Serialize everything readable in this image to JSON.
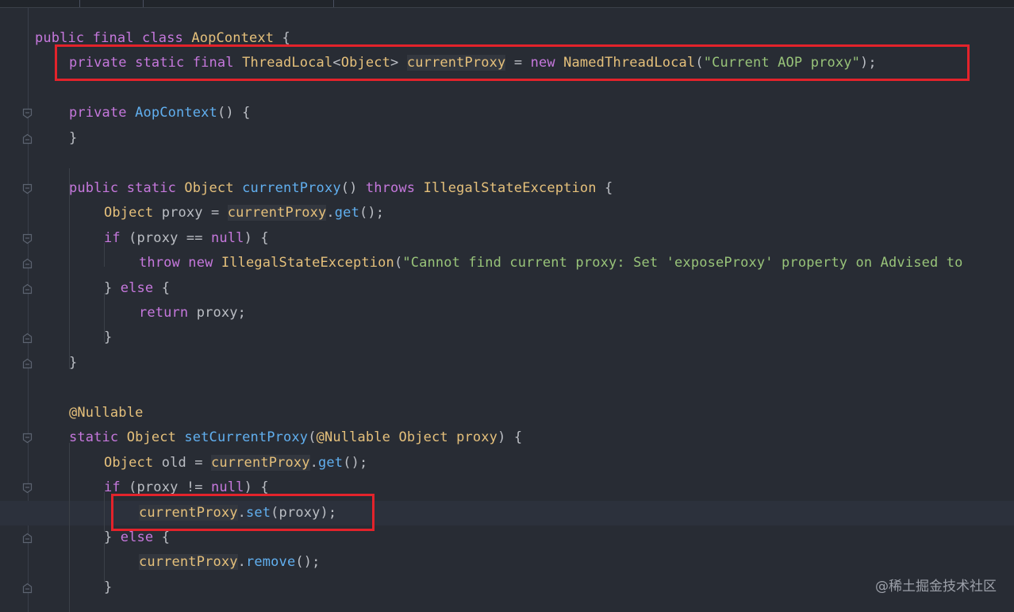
{
  "editor": {
    "lines": [
      {
        "id": "l1",
        "tokens": [
          {
            "c": "k",
            "t": "public final class "
          },
          {
            "c": "t",
            "t": "AopContext"
          },
          {
            "c": "p",
            "t": " {"
          }
        ]
      },
      {
        "id": "l2",
        "tokens": [
          {
            "c": "k",
            "t": "private static final "
          },
          {
            "c": "t",
            "t": "ThreadLocal"
          },
          {
            "c": "p",
            "t": "<"
          },
          {
            "c": "t",
            "t": "Object"
          },
          {
            "c": "p",
            "t": "> "
          },
          {
            "c": "v hl",
            "t": "currentProxy"
          },
          {
            "c": "p",
            "t": " = "
          },
          {
            "c": "k",
            "t": "new "
          },
          {
            "c": "t",
            "t": "NamedThreadLocal"
          },
          {
            "c": "p",
            "t": "("
          },
          {
            "c": "s",
            "t": "\"Current AOP proxy\""
          },
          {
            "c": "p",
            "t": ");"
          }
        ]
      },
      {
        "id": "l3",
        "tokens": []
      },
      {
        "id": "l4",
        "tokens": [
          {
            "c": "k",
            "t": "private "
          },
          {
            "c": "f",
            "t": "AopContext"
          },
          {
            "c": "p",
            "t": "() {"
          }
        ]
      },
      {
        "id": "l5",
        "tokens": [
          {
            "c": "p",
            "t": "}"
          }
        ]
      },
      {
        "id": "l6",
        "tokens": []
      },
      {
        "id": "l7",
        "tokens": [
          {
            "c": "k",
            "t": "public static "
          },
          {
            "c": "t",
            "t": "Object "
          },
          {
            "c": "f",
            "t": "currentProxy"
          },
          {
            "c": "p",
            "t": "() "
          },
          {
            "c": "k",
            "t": "throws "
          },
          {
            "c": "t",
            "t": "IllegalStateException"
          },
          {
            "c": "p",
            "t": " {"
          }
        ]
      },
      {
        "id": "l8",
        "tokens": [
          {
            "c": "t",
            "t": "Object"
          },
          {
            "c": "p",
            "t": " proxy = "
          },
          {
            "c": "v hl",
            "t": "currentProxy"
          },
          {
            "c": "p",
            "t": "."
          },
          {
            "c": "f",
            "t": "get"
          },
          {
            "c": "p",
            "t": "();"
          }
        ]
      },
      {
        "id": "l9",
        "tokens": [
          {
            "c": "k",
            "t": "if "
          },
          {
            "c": "p",
            "t": "(proxy == "
          },
          {
            "c": "k",
            "t": "null"
          },
          {
            "c": "p",
            "t": ") {"
          }
        ]
      },
      {
        "id": "l10",
        "tokens": [
          {
            "c": "k",
            "t": "throw new "
          },
          {
            "c": "t",
            "t": "IllegalStateException"
          },
          {
            "c": "p",
            "t": "("
          },
          {
            "c": "s",
            "t": "\"Cannot find current proxy: Set 'exposeProxy' property on Advised to"
          }
        ]
      },
      {
        "id": "l11",
        "tokens": [
          {
            "c": "p",
            "t": "} "
          },
          {
            "c": "k",
            "t": "else "
          },
          {
            "c": "p",
            "t": "{"
          }
        ]
      },
      {
        "id": "l12",
        "tokens": [
          {
            "c": "k",
            "t": "return "
          },
          {
            "c": "p",
            "t": "proxy;"
          }
        ]
      },
      {
        "id": "l13",
        "tokens": [
          {
            "c": "p",
            "t": "}"
          }
        ]
      },
      {
        "id": "l14",
        "tokens": [
          {
            "c": "p",
            "t": "}"
          }
        ]
      },
      {
        "id": "l15",
        "tokens": []
      },
      {
        "id": "l16",
        "tokens": [
          {
            "c": "ann",
            "t": "@Nullable"
          }
        ]
      },
      {
        "id": "l17",
        "tokens": [
          {
            "c": "k",
            "t": "static "
          },
          {
            "c": "t",
            "t": "Object "
          },
          {
            "c": "f",
            "t": "setCurrentProxy"
          },
          {
            "c": "p",
            "t": "("
          },
          {
            "c": "ann",
            "t": "@Nullable "
          },
          {
            "c": "t",
            "t": "Object "
          },
          {
            "c": "v",
            "t": "proxy"
          },
          {
            "c": "p",
            "t": ") {"
          }
        ]
      },
      {
        "id": "l18",
        "tokens": [
          {
            "c": "t",
            "t": "Object"
          },
          {
            "c": "p",
            "t": " old = "
          },
          {
            "c": "v hl",
            "t": "currentProxy"
          },
          {
            "c": "p",
            "t": "."
          },
          {
            "c": "f",
            "t": "get"
          },
          {
            "c": "p",
            "t": "();"
          }
        ]
      },
      {
        "id": "l19",
        "tokens": [
          {
            "c": "k",
            "t": "if "
          },
          {
            "c": "p",
            "t": "(proxy != "
          },
          {
            "c": "k",
            "t": "null"
          },
          {
            "c": "p",
            "t": ") {"
          }
        ]
      },
      {
        "id": "l20",
        "tokens": [
          {
            "c": "v hl",
            "t": "currentProxy"
          },
          {
            "c": "p",
            "t": "."
          },
          {
            "c": "f",
            "t": "set"
          },
          {
            "c": "p",
            "t": "(proxy);"
          }
        ]
      },
      {
        "id": "l21",
        "tokens": [
          {
            "c": "p",
            "t": "} "
          },
          {
            "c": "k",
            "t": "else "
          },
          {
            "c": "p",
            "t": "{"
          }
        ]
      },
      {
        "id": "l22",
        "tokens": [
          {
            "c": "v hl",
            "t": "currentProxy"
          },
          {
            "c": "p",
            "t": "."
          },
          {
            "c": "f",
            "t": "remove"
          },
          {
            "c": "p",
            "t": "();"
          }
        ]
      },
      {
        "id": "l23",
        "tokens": [
          {
            "c": "p",
            "t": "}"
          }
        ]
      }
    ]
  },
  "watermark": "@稀土掘金技术社区",
  "colors": {
    "background": "#282c34",
    "keyword": "#c678dd",
    "type": "#e5c07b",
    "function": "#61afef",
    "string": "#98c379",
    "highlight_box": "#e3232b"
  },
  "icons": {
    "fold_marker": "fold-marker-icon"
  }
}
